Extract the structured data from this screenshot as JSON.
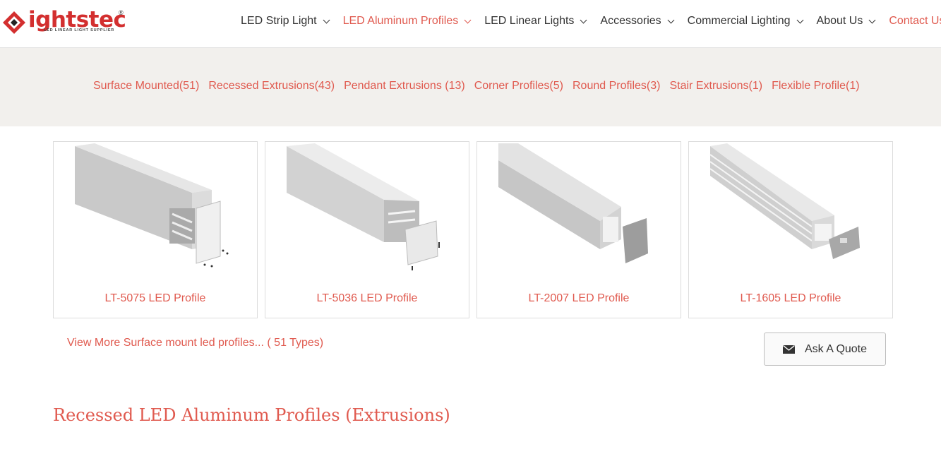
{
  "brand": {
    "logo_text": "ightstec",
    "logo_sub": "LED LINEAR LIGHT SUPPLIER",
    "registered": "®",
    "accent_color": "#e05a4f"
  },
  "nav": {
    "items": [
      {
        "label": "LED Strip Light",
        "has_dropdown": true
      },
      {
        "label": "LED Aluminum Profiles",
        "has_dropdown": true,
        "active": true
      },
      {
        "label": "LED Linear Lights",
        "has_dropdown": true
      },
      {
        "label": "Accessories",
        "has_dropdown": true
      },
      {
        "label": "Commercial Lighting",
        "has_dropdown": true
      },
      {
        "label": "About Us",
        "has_dropdown": true
      },
      {
        "label": "Contact Us",
        "has_dropdown": false
      }
    ]
  },
  "categories": [
    "Surface Mounted(51)",
    "Recessed Extrusions(43)",
    "Pendant Extrusions (13)",
    "Corner Profiles(5)",
    "Round Profiles(3)",
    "Stair Extrusions(1)",
    "Flexible Profile(1)"
  ],
  "products": [
    {
      "title": "LT-5075 LED Profile",
      "image_icon": "square-profile-icon"
    },
    {
      "title": "LT-5036 LED Profile",
      "image_icon": "wide-profile-icon"
    },
    {
      "title": "LT-2007 LED Profile",
      "image_icon": "u-profile-icon"
    },
    {
      "title": "LT-1605 LED Profile",
      "image_icon": "ribbed-profile-icon"
    }
  ],
  "view_more": "View More Surface mount led profiles... ( 51 Types)",
  "quote_button": {
    "label": "Ask A Quote",
    "icon": "envelope-icon"
  },
  "section_title": "Recessed LED Aluminum Profiles (Extrusions)"
}
